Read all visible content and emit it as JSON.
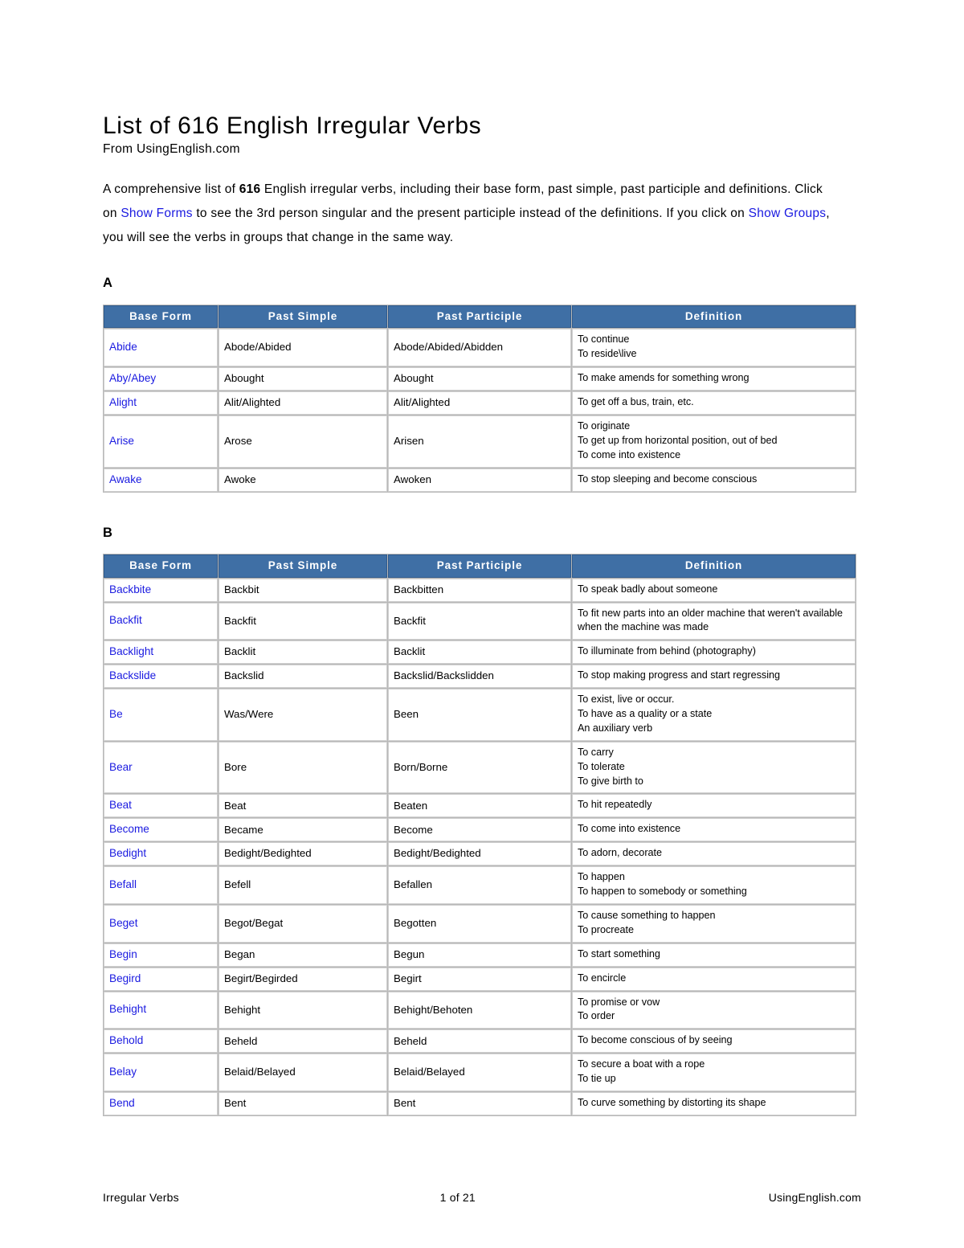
{
  "document": {
    "title": "List of 616 English Irregular Verbs",
    "subtitle": "From UsingEnglish.com",
    "intro": {
      "part1": "A comprehensive list of ",
      "count": "616",
      "part2": " English irregular verbs, including their base form, past simple, past participle and definitions. Click on ",
      "link1": "Show Forms",
      "part3": " to see the 3rd person singular and the present participle instead of the definitions. If you click on ",
      "link2": "Show Groups",
      "part4": ", you will see the verbs in groups that change in the same way."
    }
  },
  "colors": {
    "header_blue": "#3f6fa5",
    "link_blue": "#1a1ae0",
    "grid_gray": "#d0d0d0"
  },
  "columns": [
    "Base Form",
    "Past Simple",
    "Past Participle",
    "Definition"
  ],
  "sections": [
    {
      "letter": "A",
      "rows": [
        {
          "base": "Abide",
          "past": "Abode/Abided",
          "participle": "Abode/Abided/Abidden",
          "definition": "To continue\nTo reside\\live"
        },
        {
          "base": "Aby/Abey",
          "past": "Abought",
          "participle": "Abought",
          "definition": "To make amends for something wrong"
        },
        {
          "base": "Alight",
          "past": "Alit/Alighted",
          "participle": "Alit/Alighted",
          "definition": "To get off a bus, train, etc."
        },
        {
          "base": "Arise",
          "past": "Arose",
          "participle": "Arisen",
          "definition": "To originate\nTo get up from horizontal position, out of bed\nTo come into existence"
        },
        {
          "base": "Awake",
          "past": "Awoke",
          "participle": "Awoken",
          "definition": "To stop sleeping and become conscious"
        }
      ]
    },
    {
      "letter": "B",
      "rows": [
        {
          "base": "Backbite",
          "past": "Backbit",
          "participle": "Backbitten",
          "definition": "To speak badly about someone"
        },
        {
          "base": "Backfit",
          "past": "Backfit",
          "participle": "Backfit",
          "definition": "To fit new parts into an older machine that weren't available when the machine was made"
        },
        {
          "base": "Backlight",
          "past": "Backlit",
          "participle": "Backlit",
          "definition": "To illuminate from behind (photography)"
        },
        {
          "base": "Backslide",
          "past": "Backslid",
          "participle": "Backslid/Backslidden",
          "definition": "To stop making progress and start regressing"
        },
        {
          "base": "Be",
          "past": "Was/Were",
          "participle": "Been",
          "definition": "To exist, live or occur.\nTo have as a quality or a state\nAn auxiliary verb"
        },
        {
          "base": "Bear",
          "past": "Bore",
          "participle": "Born/Borne",
          "definition": "To carry\nTo tolerate\nTo give birth to"
        },
        {
          "base": "Beat",
          "past": "Beat",
          "participle": "Beaten",
          "definition": "To hit repeatedly"
        },
        {
          "base": "Become",
          "past": "Became",
          "participle": "Become",
          "definition": "To come into existence"
        },
        {
          "base": "Bedight",
          "past": "Bedight/Bedighted",
          "participle": "Bedight/Bedighted",
          "definition": "To adorn, decorate"
        },
        {
          "base": "Befall",
          "past": "Befell",
          "participle": "Befallen",
          "definition": "To happen\nTo happen to somebody or something"
        },
        {
          "base": "Beget",
          "past": "Begot/Begat",
          "participle": "Begotten",
          "definition": "To cause something to happen\nTo procreate"
        },
        {
          "base": "Begin",
          "past": "Began",
          "participle": "Begun",
          "definition": "To start something"
        },
        {
          "base": "Begird",
          "past": "Begirt/Begirded",
          "participle": "Begirt",
          "definition": "To encircle"
        },
        {
          "base": "Behight",
          "past": "Behight",
          "participle": "Behight/Behoten",
          "definition": "To promise or vow\nTo order"
        },
        {
          "base": "Behold",
          "past": "Beheld",
          "participle": "Beheld",
          "definition": "To become conscious of by seeing"
        },
        {
          "base": "Belay",
          "past": "Belaid/Belayed",
          "participle": "Belaid/Belayed",
          "definition": "To secure a boat with a rope\nTo tie up"
        },
        {
          "base": "Bend",
          "past": "Bent",
          "participle": "Bent",
          "definition": "To curve something by distorting its shape"
        }
      ]
    }
  ],
  "footer": {
    "left": "Irregular Verbs",
    "center": "1 of 21",
    "right": "UsingEnglish.com"
  }
}
